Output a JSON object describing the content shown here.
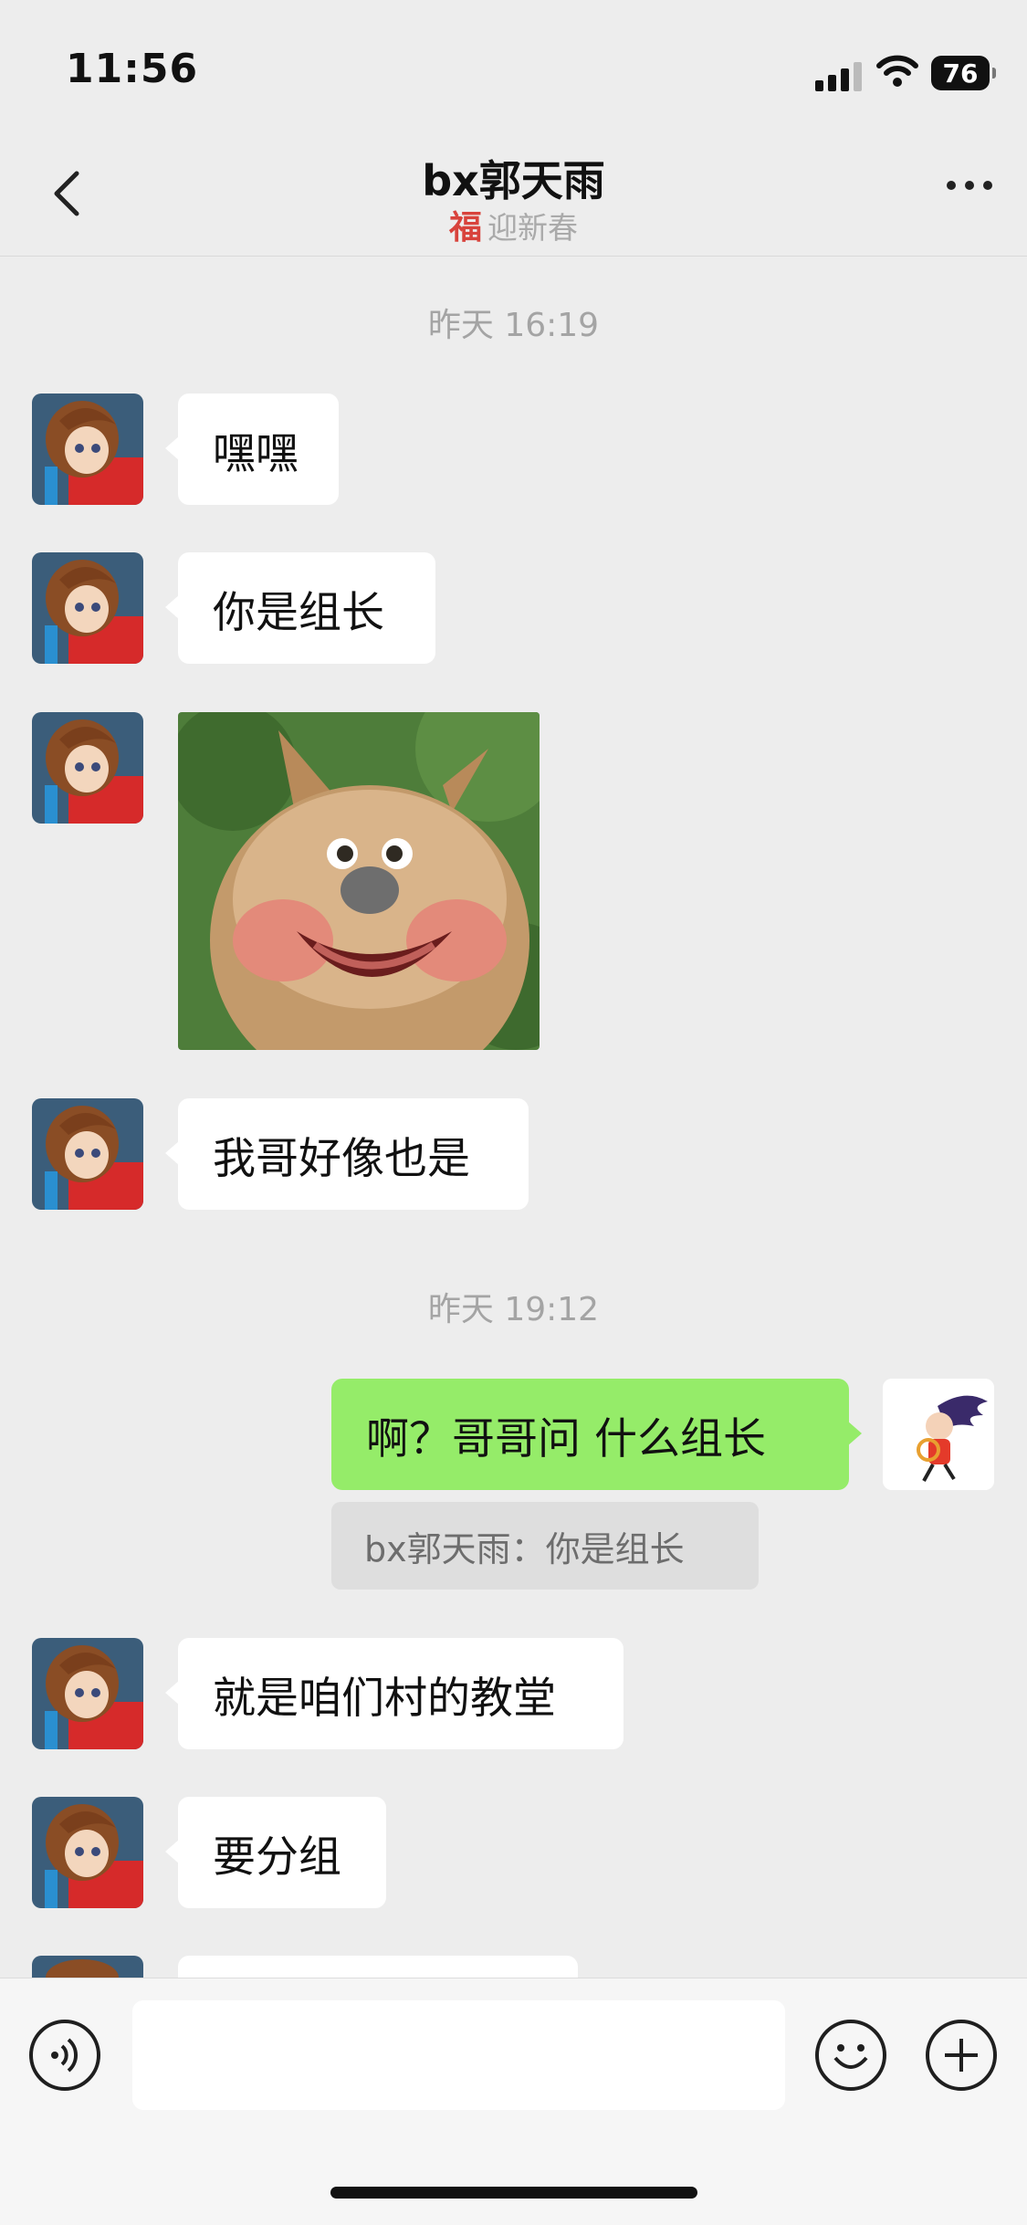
{
  "status_bar": {
    "time": "11:56",
    "battery": "76"
  },
  "header": {
    "title": "bx郭天雨",
    "subtitle_icon": "福",
    "subtitle": "迎新春"
  },
  "messages": [
    {
      "type": "timestamp",
      "text": "昨天 16:19"
    },
    {
      "type": "text",
      "side": "left",
      "text": "嘿嘿"
    },
    {
      "type": "text",
      "side": "left",
      "text": "你是组长"
    },
    {
      "type": "sticker",
      "side": "left",
      "description": "bear-sticker"
    },
    {
      "type": "text",
      "side": "left",
      "text": "我哥好像也是"
    },
    {
      "type": "timestamp",
      "text": "昨天 19:12"
    },
    {
      "type": "text",
      "side": "right",
      "text": "啊？哥哥问 什么组长",
      "quote": "bx郭天雨：你是组长"
    },
    {
      "type": "text",
      "side": "left",
      "text": "就是咱们村的教堂"
    },
    {
      "type": "text",
      "side": "left",
      "text": "要分组"
    }
  ],
  "icons": {
    "back": "chevron-left-icon",
    "more": "more-dots-icon",
    "voice": "voice-icon",
    "emoji": "emoji-icon",
    "plus": "plus-icon"
  },
  "colors": {
    "background": "#ededed",
    "self_bubble": "#95ec69",
    "other_bubble": "#ffffff"
  }
}
